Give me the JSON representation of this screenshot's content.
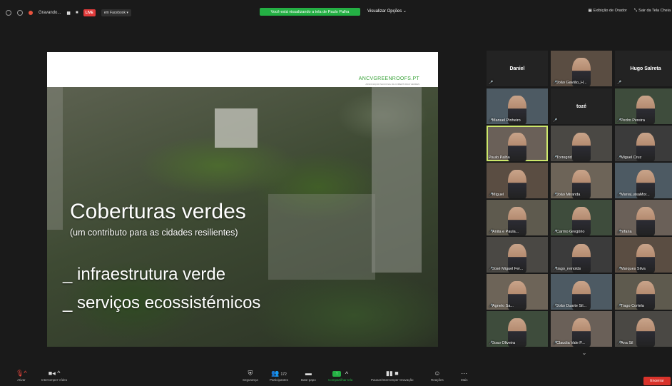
{
  "topbar": {
    "recording_label": "Gravando...",
    "pause_icon": "pause-icon",
    "stop_icon": "stop-icon",
    "live_label": "LIVE",
    "live_platform": "em Facebook ▾",
    "share_banner": "Você está visualizando a tela de Paulo Palha",
    "view_options": "Visualizar Opções ⌄",
    "speaker_view": "Exibição de Orador",
    "exit_fullscreen": "Sair da Tela Cheia"
  },
  "slide": {
    "logo": "ANCVGREENROOFS.PT",
    "logo_sub": "ASSOCIAÇÃO NACIONAL DE COBERTURAS VERDES",
    "title": "Coberturas verdes",
    "subtitle": "(um contributo para as cidades resilientes)",
    "bullet1": "_ infraestrutura verde",
    "bullet2": "_ serviços ecossistémicos"
  },
  "gallery": [
    {
      "name": "Daniel",
      "center_name": "Daniel",
      "muted": true
    },
    {
      "name": "João Gavião_H...",
      "center_name": "",
      "muted": true
    },
    {
      "name": "Hugo Salreta",
      "center_name": "Hugo Salreta",
      "muted": true
    },
    {
      "name": "Manuel Pinheiro",
      "center_name": "",
      "muted": true
    },
    {
      "name": "tozé",
      "center_name": "tozé",
      "muted": true
    },
    {
      "name": "Pedro Pereira",
      "center_name": "",
      "muted": true
    },
    {
      "name": "Paulo Palha",
      "center_name": "",
      "muted": false
    },
    {
      "name": "Torregrid",
      "center_name": "",
      "muted": true
    },
    {
      "name": "Miguel Cruz",
      "center_name": "",
      "muted": true
    },
    {
      "name": "Miguel",
      "center_name": "",
      "muted": true
    },
    {
      "name": "João Miranda",
      "center_name": "",
      "muted": true
    },
    {
      "name": "MariaLuisaMor...",
      "center_name": "",
      "muted": true
    },
    {
      "name": "Anita e Paula...",
      "center_name": "",
      "muted": true
    },
    {
      "name": "Carmo Gregório",
      "center_name": "",
      "muted": true
    },
    {
      "name": "hrfaria",
      "center_name": "",
      "muted": true
    },
    {
      "name": "José Miguel Fer...",
      "center_name": "",
      "muted": true
    },
    {
      "name": "tiago_reinolds",
      "center_name": "",
      "muted": true
    },
    {
      "name": "Marques Silva",
      "center_name": "",
      "muted": true
    },
    {
      "name": "Agnelo Sa...",
      "center_name": "",
      "muted": true
    },
    {
      "name": "João Duarte Sil...",
      "center_name": "",
      "muted": true
    },
    {
      "name": "Tiago Cortela",
      "center_name": "",
      "muted": true
    },
    {
      "name": "Joao Oliveira",
      "center_name": "",
      "muted": true
    },
    {
      "name": "Claudia Vale P...",
      "center_name": "",
      "muted": true
    },
    {
      "name": "Ana Sil",
      "center_name": "",
      "muted": true
    }
  ],
  "bottombar": {
    "mute": "Ativar",
    "video": "Interromper Vídeo",
    "security": "Segurança",
    "participants": "Participantes",
    "participants_count": "172",
    "chat": "Bate-papo",
    "share": "Compartilhar tela",
    "record": "Pausar/Interromper Gravação",
    "reactions": "Reações",
    "more": "Mais",
    "end": "Encerrar"
  },
  "colors": {
    "share_green": "#24b044",
    "live_red": "#e03a3a",
    "active_speaker": "#cde86b",
    "end_red": "#d9332b"
  }
}
